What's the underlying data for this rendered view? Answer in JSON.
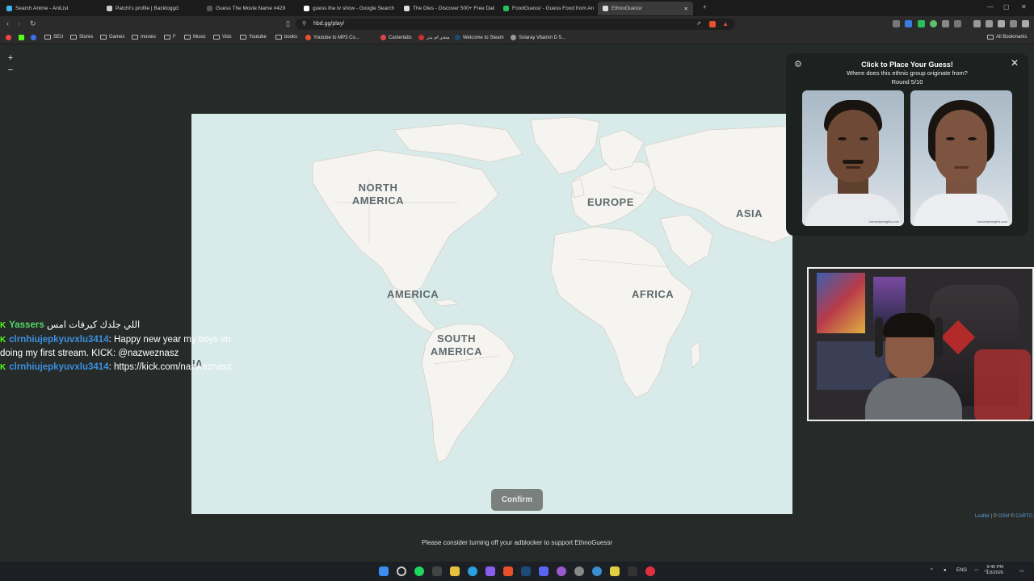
{
  "browser": {
    "tabs": [
      {
        "label": "Search Anime - AniList",
        "icon_color": "#3db4f2",
        "active": false
      },
      {
        "label": "Patchi's profile | Backloggd",
        "icon_color": "#cccccc",
        "active": false
      },
      {
        "label": "Guess The Movie.Name #429",
        "icon_color": "#555555",
        "active": false
      },
      {
        "label": "guess the tv show - Google Search",
        "icon_color": "#ffffff",
        "active": false
      },
      {
        "label": "The Dles - Discover 500+ Free Daily",
        "icon_color": "#dddddd",
        "active": false
      },
      {
        "label": "FoodGuessr - Guess Food from Arou",
        "icon_color": "#21c25e",
        "active": false
      },
      {
        "label": "EthnoGuessr",
        "icon_color": "#dddddd",
        "active": true
      }
    ],
    "url": "hbd.gg/play/",
    "bookmarks": [
      {
        "label": "SEU",
        "type": "folder"
      },
      {
        "label": "Stores",
        "type": "folder"
      },
      {
        "label": "Games",
        "type": "folder"
      },
      {
        "label": "movies",
        "type": "folder"
      },
      {
        "label": "F",
        "type": "folder"
      },
      {
        "label": "Music",
        "type": "folder"
      },
      {
        "label": "Vids",
        "type": "folder"
      },
      {
        "label": "Youtube",
        "type": "folder"
      },
      {
        "label": "books",
        "type": "folder"
      },
      {
        "label": "Youtube to MP3 Co...",
        "type": "site"
      },
      {
        "label": "Casterlabs",
        "type": "site"
      },
      {
        "label": "متجر ام بدر",
        "type": "site"
      },
      {
        "label": "Welcome to Steam",
        "type": "site"
      },
      {
        "label": "Solaray Vitamin D 5...",
        "type": "site"
      }
    ],
    "all_bookmarks": "All Bookmarks"
  },
  "map": {
    "zoom_in": "+",
    "zoom_out": "−",
    "labels": {
      "north_america": "NORTH\nAMERICA",
      "europe": "EUROPE",
      "asia": "ASIA",
      "america": "AMERICA",
      "africa": "AFRICA",
      "south_america": "SOUTH\nAMERICA",
      "ia_fragment": "IA"
    },
    "confirm_label": "Confirm",
    "attribution": {
      "leaflet": "Leaflet",
      "sep1": " | © ",
      "osm": "OSM",
      "sep2": " © ",
      "carto": "CARTO"
    }
  },
  "panel": {
    "title": "Click to Place Your Guess!",
    "question": "Where does this ethnic group originate from?",
    "round": "Round 5/10",
    "close": "✕",
    "gear": "⚙",
    "faces": [
      {
        "alt": "male face",
        "watermark": "humanlyinsights.com"
      },
      {
        "alt": "female face",
        "watermark": "humanlyinsights.com"
      }
    ]
  },
  "chat": [
    {
      "user": "Yassers",
      "user_style": "green",
      "message": " اللي جلدك كيرفات امس"
    },
    {
      "user": "clrnhiujepkyuvxlu3414",
      "user_style": "blue",
      "message": ": Happy new year my boys im doing my first stream. KICK: @nazweznasz"
    },
    {
      "user": "clrnhiujepkyuvxlu3414",
      "user_style": "blue",
      "message": ": https://kick.com/nazweznasz"
    }
  ],
  "footer": {
    "adblock_note": "Please consider turning off your adblocker to support EthnoGuessr"
  },
  "taskbar": {
    "language": "ENG",
    "time": "9:40 PM",
    "date": "1/3/2026"
  }
}
